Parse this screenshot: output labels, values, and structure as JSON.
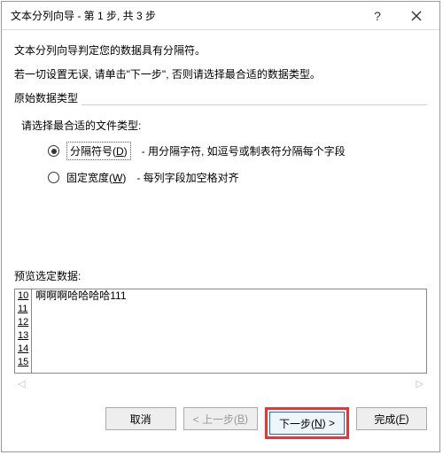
{
  "titlebar": {
    "title": "文本分列向导 - 第 1 步, 共 3 步"
  },
  "intro": {
    "line1": "文本分列向导判定您的数据具有分隔符。",
    "line2": "若一切设置无误, 请单击\"下一步\", 否则请选择最合适的数据类型。"
  },
  "original_type": {
    "legend": "原始数据类型",
    "prompt": "请选择最合适的文件类型:",
    "options": [
      {
        "label": "分隔符号(D)",
        "desc": "- 用分隔字符, 如逗号或制表符分隔每个字段",
        "selected": true
      },
      {
        "label": "固定宽度(W)",
        "desc": "- 每列字段加空格对齐",
        "selected": false
      }
    ]
  },
  "preview": {
    "label": "预览选定数据:",
    "row_numbers": [
      "10",
      "11",
      "12",
      "13",
      "14",
      "15"
    ],
    "rows": [
      "啊啊啊哈哈哈哈111",
      "",
      "",
      "",
      "",
      ""
    ]
  },
  "buttons": {
    "cancel": "取消",
    "back": "< 上一步(B)",
    "next": "下一步(N) >",
    "finish": "完成(F)"
  }
}
